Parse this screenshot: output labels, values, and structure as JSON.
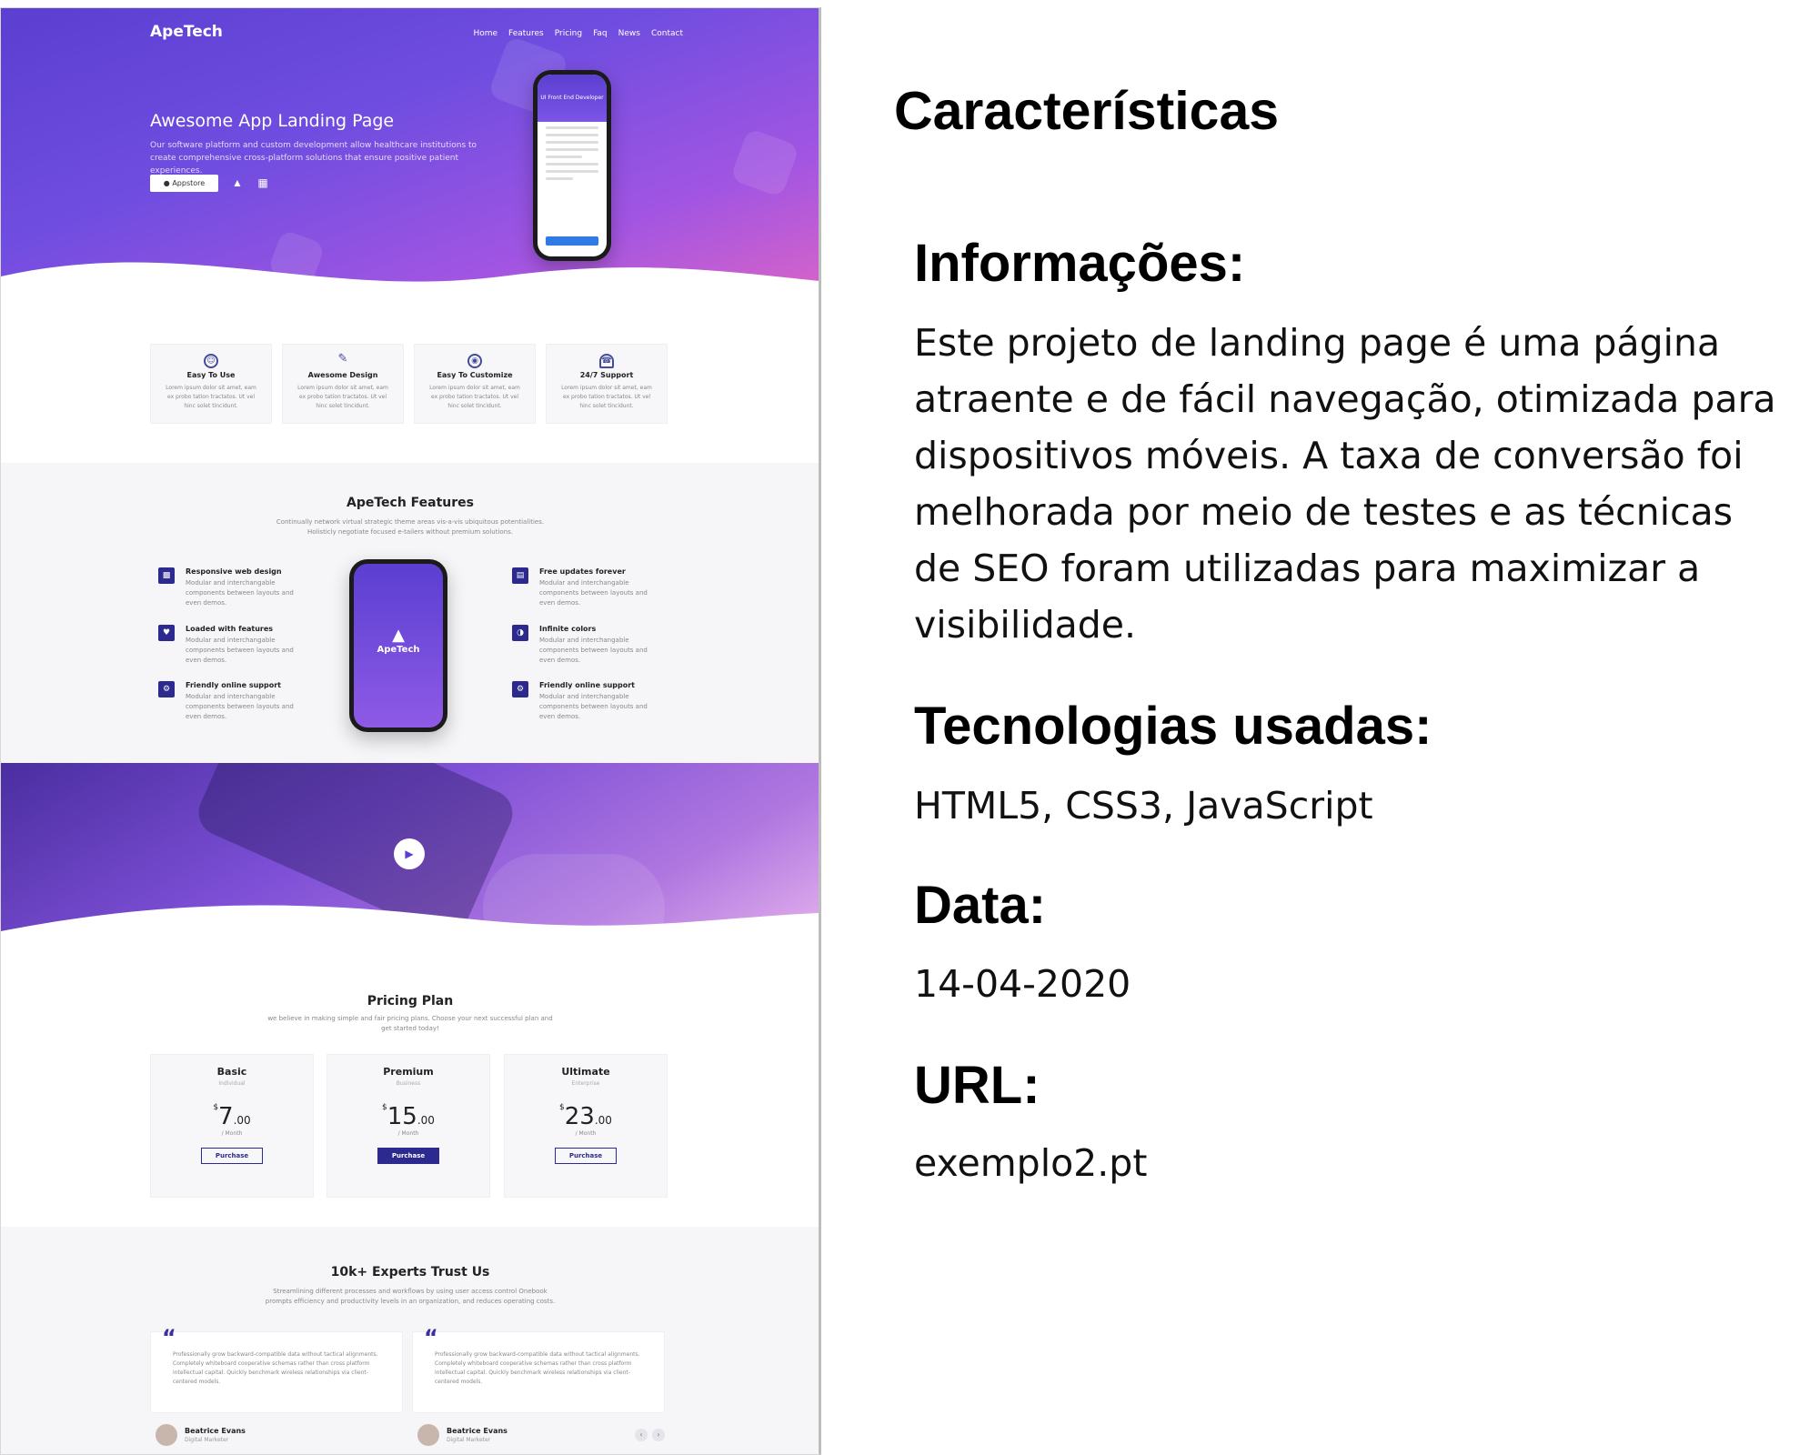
{
  "preview": {
    "nav": {
      "logo": "ApeTech",
      "links": [
        "Home",
        "Features",
        "Pricing",
        "Faq",
        "News",
        "Contact"
      ]
    },
    "hero": {
      "title": "Awesome App Landing Page",
      "desc": "Our software platform and custom development allow healthcare institutions to create comprehensive cross-platform solutions that ensure positive patient experiences.",
      "appstore_label": "Appstore",
      "phone_header": "UI Front End Developer"
    },
    "feature_cards": [
      {
        "title": "Easy To Use",
        "desc": "Lorem ipsum dolor sit amet, eam ex probo tation tractatos. Ut vel hinc solet tincidunt."
      },
      {
        "title": "Awesome Design",
        "desc": "Lorem ipsum dolor sit amet, eam ex probo tation tractatos. Ut vel hinc solet tincidunt."
      },
      {
        "title": "Easy To Customize",
        "desc": "Lorem ipsum dolor sit amet, eam ex probo tation tractatos. Ut vel hinc solet tincidunt."
      },
      {
        "title": "24/7 Support",
        "desc": "Lorem ipsum dolor sit amet, eam ex probo tation tractatos. Ut vel hinc solet tincidunt."
      }
    ],
    "features": {
      "title": "ApeTech Features",
      "subtitle": "Continually network virtual strategic theme areas vis-a-vis ubiquitous potentialities. Holisticly negotiate focused e-tailers without premium solutions.",
      "phone_logo": "ApeTech",
      "left": [
        {
          "title": "Responsive web design",
          "desc": "Modular and interchangable components between layouts and even demos."
        },
        {
          "title": "Loaded with features",
          "desc": "Modular and interchangable components between layouts and even demos."
        },
        {
          "title": "Friendly online support",
          "desc": "Modular and interchangable components between layouts and even demos."
        }
      ],
      "right": [
        {
          "title": "Free updates forever",
          "desc": "Modular and interchangable components between layouts and even demos."
        },
        {
          "title": "Infinite colors",
          "desc": "Modular and interchangable components between layouts and even demos."
        },
        {
          "title": "Friendly online support",
          "desc": "Modular and interchangable components between layouts and even demos."
        }
      ]
    },
    "pricing": {
      "title": "Pricing Plan",
      "subtitle": "we believe in making simple and fair pricing plans. Choose your next successful plan and get started today!",
      "plans": [
        {
          "name": "Basic",
          "sub": "Individual",
          "currency": "$",
          "price": "7",
          "cents": ".00",
          "per": "/ Month",
          "button": "Purchase"
        },
        {
          "name": "Premium",
          "sub": "Business",
          "currency": "$",
          "price": "15",
          "cents": ".00",
          "per": "/ Month",
          "button": "Purchase"
        },
        {
          "name": "Ultimate",
          "sub": "Enterprise",
          "currency": "$",
          "price": "23",
          "cents": ".00",
          "per": "/ Month",
          "button": "Purchase"
        }
      ]
    },
    "testimonials": {
      "title": "10k+ Experts Trust Us",
      "subtitle": "Streamlining different processes and workflows by using user access control Onebook prompts efficiency and productivity levels in an organization, and reduces operating costs.",
      "items": [
        {
          "quote": "Professionally grow backward-compatible data without tactical alignments. Completely whiteboard cooperative schemas rather than cross platform intellectual capital. Quickly benchmark wireless relationships via client-centered models.",
          "name": "Beatrice Evans",
          "role": "Digital Marketer"
        },
        {
          "quote": "Professionally grow backward-compatible data without tactical alignments. Completely whiteboard cooperative schemas rather than cross platform intellectual capital. Quickly benchmark wireless relationships via client-centered models.",
          "name": "Beatrice Evans",
          "role": "Digital Marketer"
        }
      ]
    }
  },
  "panel": {
    "title": "Características",
    "info_heading": "Informações:",
    "info_text": "Este projeto de landing page é uma página atraente e de fácil navegação, otimizada para dispositivos móveis. A taxa de conversão foi melhorada por meio de testes e as técnicas de SEO foram utilizadas para maximizar a visibilidade.",
    "tech_heading": "Tecnologias usadas:",
    "tech_text": "HTML5, CSS3, JavaScript",
    "date_heading": "Data:",
    "date_text": "14-04-2020",
    "url_heading": "URL:",
    "url_text": "exemplo2.pt"
  },
  "colors": {
    "brand_purple": "#5b3fd1",
    "brand_navy": "#2c2a8f",
    "accent_pink": "#d864c8"
  }
}
